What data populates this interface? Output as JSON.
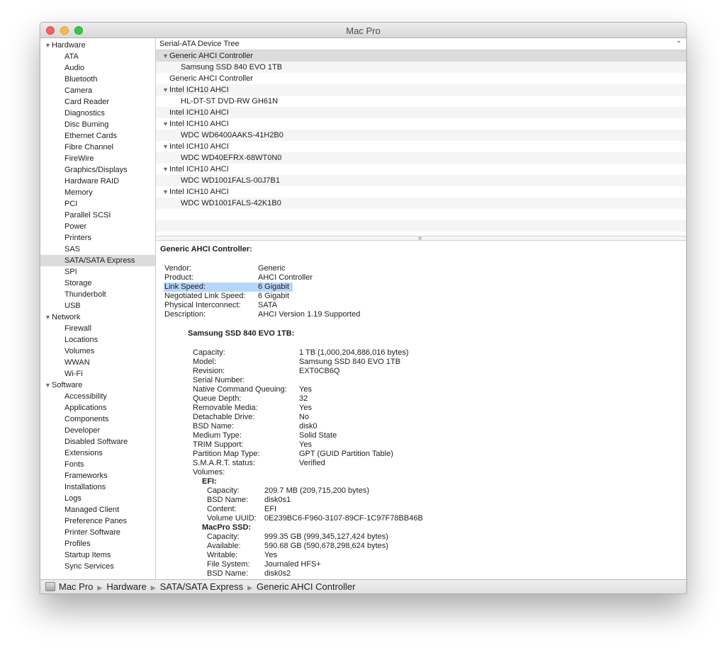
{
  "window": {
    "title": "Mac Pro"
  },
  "sidebar": {
    "categories": [
      {
        "label": "Hardware",
        "items": [
          "ATA",
          "Audio",
          "Bluetooth",
          "Camera",
          "Card Reader",
          "Diagnostics",
          "Disc Burning",
          "Ethernet Cards",
          "Fibre Channel",
          "FireWire",
          "Graphics/Displays",
          "Hardware RAID",
          "Memory",
          "PCI",
          "Parallel SCSI",
          "Power",
          "Printers",
          "SAS",
          "SATA/SATA Express",
          "SPI",
          "Storage",
          "Thunderbolt",
          "USB"
        ]
      },
      {
        "label": "Network",
        "items": [
          "Firewall",
          "Locations",
          "Volumes",
          "WWAN",
          "Wi-Fi"
        ]
      },
      {
        "label": "Software",
        "items": [
          "Accessibility",
          "Applications",
          "Components",
          "Developer",
          "Disabled Software",
          "Extensions",
          "Fonts",
          "Frameworks",
          "Installations",
          "Logs",
          "Managed Client",
          "Preference Panes",
          "Printer Software",
          "Profiles",
          "Startup Items",
          "Sync Services"
        ]
      }
    ],
    "selected": "SATA/SATA Express"
  },
  "tree": {
    "header": "Serial-ATA Device Tree",
    "rows": [
      {
        "label": "Generic AHCI Controller",
        "level": 0,
        "expanded": true,
        "selected": true
      },
      {
        "label": "Samsung SSD 840 EVO 1TB",
        "level": 1
      },
      {
        "label": "Generic AHCI Controller",
        "level": 0
      },
      {
        "label": "Intel ICH10 AHCI",
        "level": 0,
        "expanded": true
      },
      {
        "label": "HL-DT-ST DVD-RW GH61N",
        "level": 1
      },
      {
        "label": "Intel ICH10 AHCI",
        "level": 0
      },
      {
        "label": "Intel ICH10 AHCI",
        "level": 0,
        "expanded": true
      },
      {
        "label": "WDC WD6400AAKS-41H2B0",
        "level": 1
      },
      {
        "label": "Intel ICH10 AHCI",
        "level": 0,
        "expanded": true
      },
      {
        "label": "WDC WD40EFRX-68WT0N0",
        "level": 1
      },
      {
        "label": "Intel ICH10 AHCI",
        "level": 0,
        "expanded": true
      },
      {
        "label": "WDC WD1001FALS-00J7B1",
        "level": 1
      },
      {
        "label": "Intel ICH10 AHCI",
        "level": 0,
        "expanded": true
      },
      {
        "label": "WDC WD1001FALS-42K1B0",
        "level": 1
      }
    ]
  },
  "detail": {
    "controller_title": "Generic AHCI Controller:",
    "controller_props": [
      {
        "key": "Vendor:",
        "value": "Generic"
      },
      {
        "key": "Product:",
        "value": "AHCI Controller"
      },
      {
        "key": "Link Speed:",
        "value": "6 Gigabit",
        "highlighted": true
      },
      {
        "key": "Negotiated Link Speed:",
        "value": "6 Gigabit"
      },
      {
        "key": "Physical Interconnect:",
        "value": "SATA"
      },
      {
        "key": "Description:",
        "value": "AHCI Version 1.19 Supported"
      }
    ],
    "device_title": "Samsung SSD 840 EVO 1TB:",
    "device_props": [
      {
        "key": "Capacity:",
        "value": "1 TB (1,000,204,886,016 bytes)"
      },
      {
        "key": "Model:",
        "value": "Samsung SSD 840 EVO 1TB"
      },
      {
        "key": "Revision:",
        "value": "EXT0CB6Q"
      },
      {
        "key": "Serial Number:",
        "value": ""
      },
      {
        "key": "Native Command Queuing:",
        "value": "Yes"
      },
      {
        "key": "Queue Depth:",
        "value": "32"
      },
      {
        "key": "Removable Media:",
        "value": "Yes"
      },
      {
        "key": "Detachable Drive:",
        "value": "No"
      },
      {
        "key": "BSD Name:",
        "value": "disk0"
      },
      {
        "key": "Medium Type:",
        "value": "Solid State"
      },
      {
        "key": "TRIM Support:",
        "value": "Yes"
      },
      {
        "key": "Partition Map Type:",
        "value": "GPT (GUID Partition Table)"
      },
      {
        "key": "S.M.A.R.T. status:",
        "value": "Verified"
      },
      {
        "key": "Volumes:",
        "value": ""
      }
    ],
    "volumes": [
      {
        "name": "EFI:",
        "props": [
          {
            "key": "Capacity:",
            "value": "209.7 MB (209,715,200 bytes)"
          },
          {
            "key": "BSD Name:",
            "value": "disk0s1"
          },
          {
            "key": "Content:",
            "value": "EFI"
          },
          {
            "key": "Volume UUID:",
            "value": "0E239BC6-F960-3107-89CF-1C97F78BB46B"
          }
        ]
      },
      {
        "name": "MacPro SSD:",
        "props": [
          {
            "key": "Capacity:",
            "value": "999.35 GB (999,345,127,424 bytes)"
          },
          {
            "key": "Available:",
            "value": "590.68 GB (590,678,298,624 bytes)"
          },
          {
            "key": "Writable:",
            "value": "Yes"
          },
          {
            "key": "File System:",
            "value": "Journaled HFS+"
          },
          {
            "key": "BSD Name:",
            "value": "disk0s2"
          }
        ]
      }
    ]
  },
  "pathbar": {
    "items": [
      "Mac Pro",
      "Hardware",
      "SATA/SATA Express",
      "Generic AHCI Controller"
    ]
  }
}
